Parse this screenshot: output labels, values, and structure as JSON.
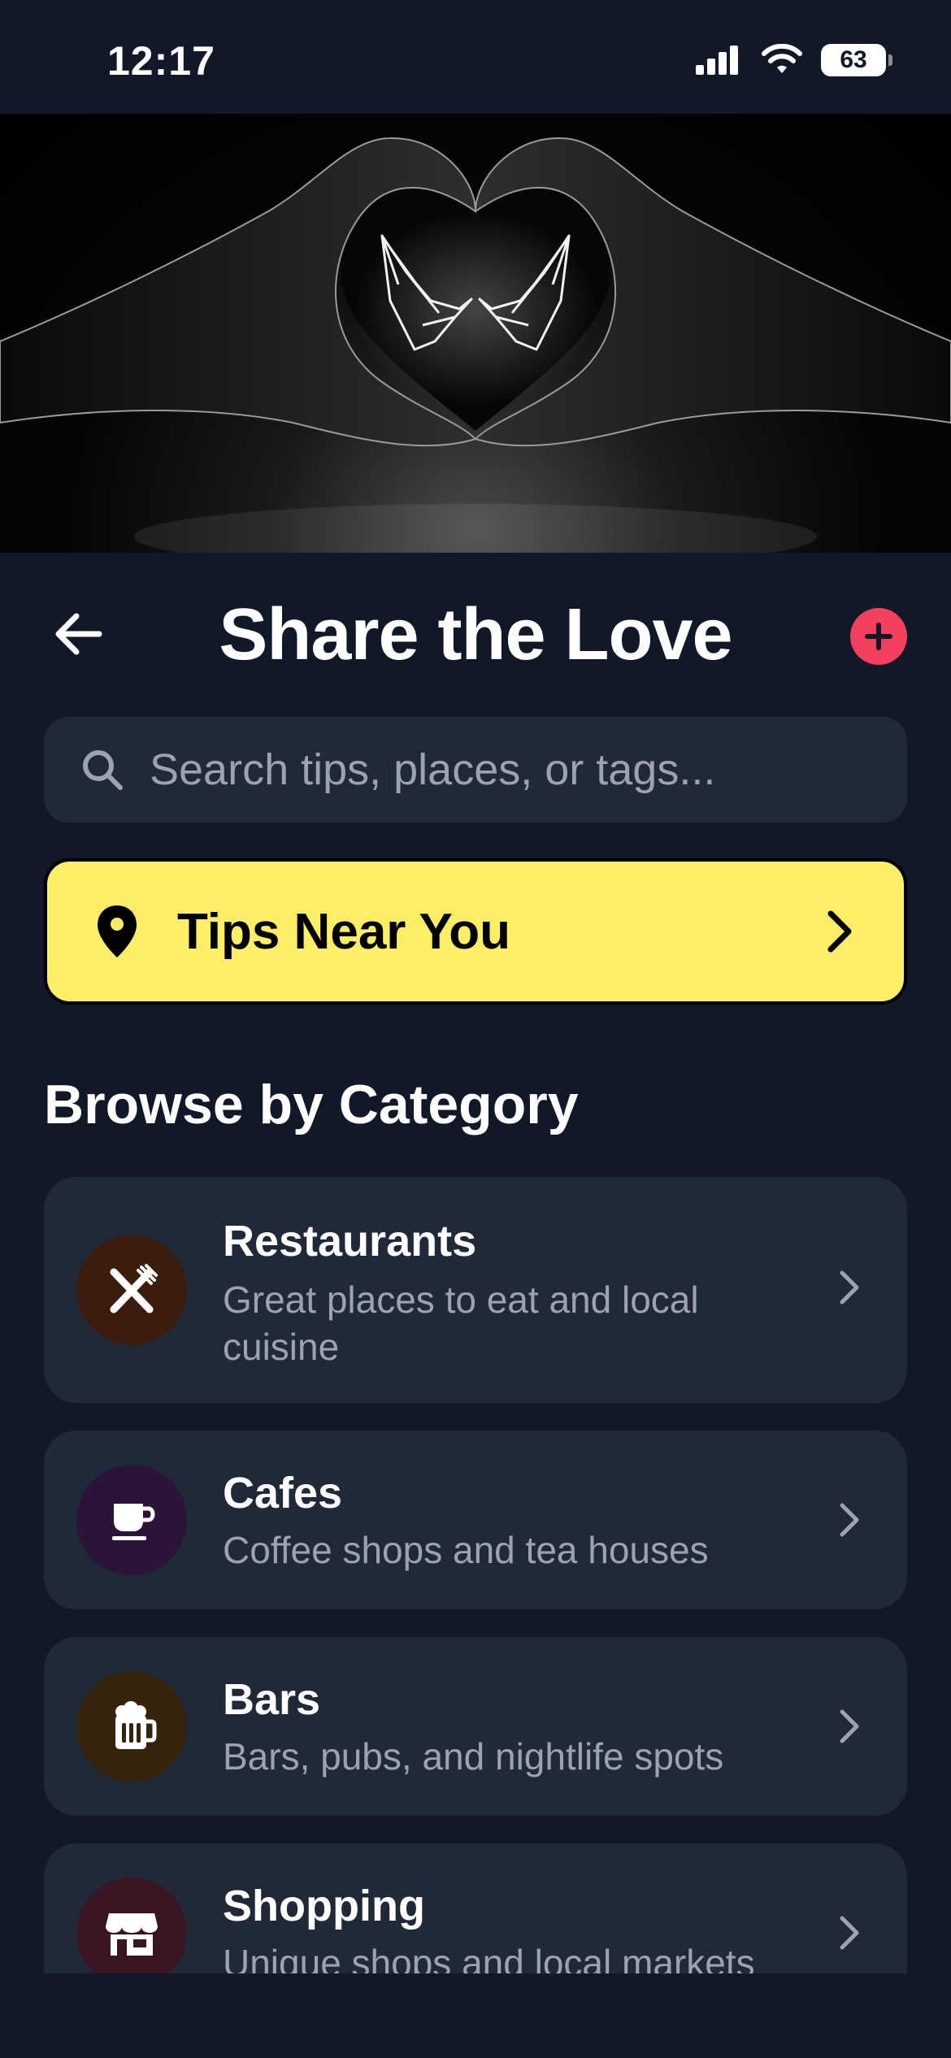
{
  "status_bar": {
    "time": "12:17",
    "battery": "63"
  },
  "header": {
    "title": "Share the Love"
  },
  "search": {
    "placeholder": "Search tips, places, or tags..."
  },
  "near_you": {
    "label": "Tips Near You"
  },
  "section": {
    "title": "Browse by Category"
  },
  "categories": [
    {
      "title": "Restaurants",
      "description": "Great places to eat and local cuisine",
      "icon": "fork-knife-icon",
      "icon_bg": "#3a1d0e"
    },
    {
      "title": "Cafes",
      "description": "Coffee shops and tea houses",
      "icon": "coffee-cup-icon",
      "icon_bg": "#2a1538"
    },
    {
      "title": "Bars",
      "description": "Bars, pubs, and nightlife spots",
      "icon": "beer-mug-icon",
      "icon_bg": "#36230b"
    },
    {
      "title": "Shopping",
      "description": "Unique shops and local markets",
      "icon": "storefront-icon",
      "icon_bg": "#3a1522"
    }
  ],
  "colors": {
    "background": "#111827",
    "card": "#1f2937",
    "accent_yellow": "#fdee65",
    "accent_pink": "#f43f5e"
  }
}
